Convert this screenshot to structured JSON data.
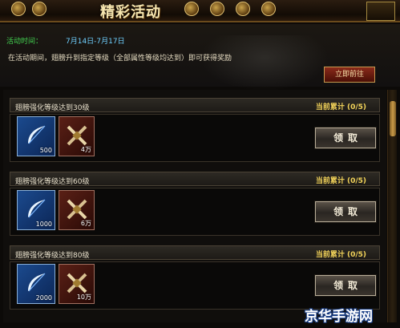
{
  "window": {
    "title": "精彩活动"
  },
  "info": {
    "time_label": "活动时间：",
    "time_range": "7月14日-7月17日",
    "description": "在活动期间，翅膀升到指定等级（全部属性等级均达到）即可获得奖励",
    "go_button": "立即前往"
  },
  "rewards": [
    {
      "title": "翅膀强化等级达到30级",
      "count": "当前累计 (0/5)",
      "items": [
        {
          "icon": "feather-icon",
          "qty": "500"
        },
        {
          "icon": "crossed-swords-icon",
          "qty": "4万"
        }
      ],
      "claim": "领取"
    },
    {
      "title": "翅膀强化等级达到60级",
      "count": "当前累计 (0/5)",
      "items": [
        {
          "icon": "feather-icon",
          "qty": "1000"
        },
        {
          "icon": "crossed-swords-icon",
          "qty": "6万"
        }
      ],
      "claim": "领取"
    },
    {
      "title": "翅膀强化等级达到80级",
      "count": "当前累计 (0/5)",
      "items": [
        {
          "icon": "feather-icon",
          "qty": "2000"
        },
        {
          "icon": "crossed-swords-icon",
          "qty": "10万"
        }
      ],
      "claim": "领取"
    }
  ],
  "watermark": "京华手游网"
}
